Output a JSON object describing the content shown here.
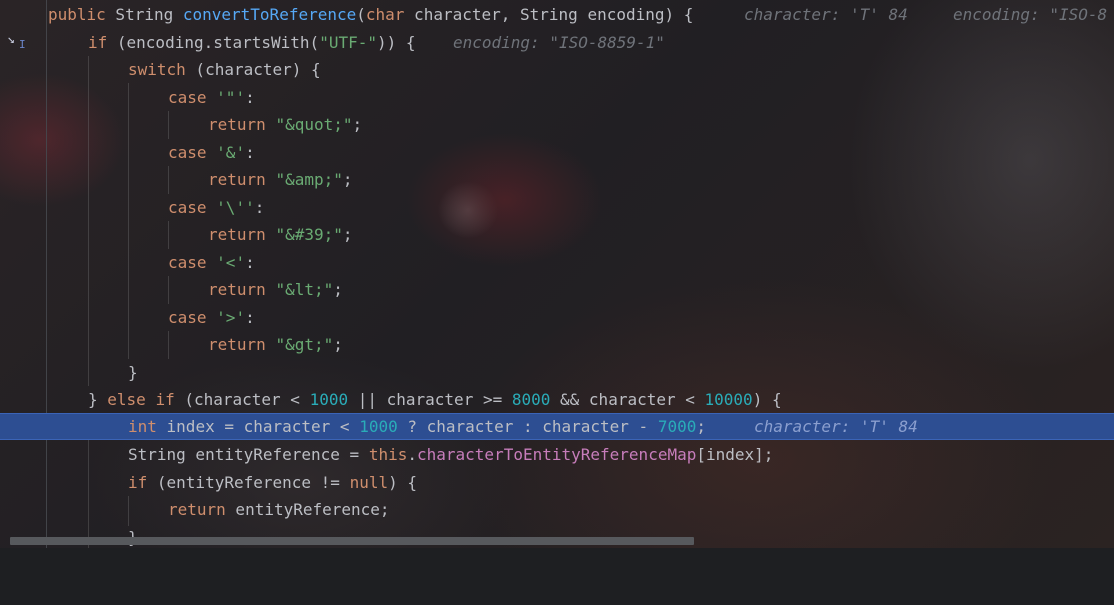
{
  "colors": {
    "keyword": "#cf8e6d",
    "method": "#56a8f5",
    "string": "#6aab73",
    "number": "#2aacb8",
    "field": "#c77dbb",
    "text": "#bcbec4",
    "inline_hint": "#6f737a",
    "execution_line": "#2d4e92"
  },
  "gutter": {
    "execution_marker_icon": "step-into-arrow-icon"
  },
  "code": {
    "l1": {
      "kw1": "public",
      "t1": " String ",
      "fn": "convertToReference",
      "t2": "(",
      "kw2": "char",
      "t3": " character, String encoding) {",
      "hint1": "character: 'T' 84",
      "hint2": "encoding: \"ISO-8"
    },
    "l2": {
      "kw": "if",
      "t1": " (encoding.startsWith(",
      "s": "\"UTF-\"",
      "t2": ")) {",
      "hint": "encoding: \"ISO-8859-1\""
    },
    "l3": {
      "kw": "switch",
      "t": " (character) {"
    },
    "l4": {
      "kw": "case",
      "s": "'\"'",
      "t": ":"
    },
    "l5": {
      "kw": "return",
      "s": "\"&quot;\"",
      "t": ";"
    },
    "l6": {
      "kw": "case",
      "s": "'&'",
      "t": ":"
    },
    "l7": {
      "kw": "return",
      "s": "\"&amp;\"",
      "t": ";"
    },
    "l8": {
      "kw": "case",
      "s": "'\\''",
      "t": ":"
    },
    "l9": {
      "kw": "return",
      "s": "\"&#39;\"",
      "t": ";"
    },
    "l10": {
      "kw": "case",
      "s": "'<'",
      "t": ":"
    },
    "l11": {
      "kw": "return",
      "s": "\"&lt;\"",
      "t": ";"
    },
    "l12": {
      "kw": "case",
      "s": "'>'",
      "t": ":"
    },
    "l13": {
      "kw": "return",
      "s": "\"&gt;\"",
      "t": ";"
    },
    "l14": {
      "t": "}"
    },
    "l15": {
      "t1": "} ",
      "kw1": "else",
      "t2": " ",
      "kw2": "if",
      "t3": " (character < ",
      "n1": "1000",
      "t4": " || character >= ",
      "n2": "8000",
      "t5": " && character < ",
      "n3": "10000",
      "t6": ") {"
    },
    "l16": {
      "kw": "int",
      "t1": " index = character < ",
      "n1": "1000",
      "t2": " ? character : character - ",
      "n2": "7000",
      "t3": ";",
      "hint": "character: 'T' 84"
    },
    "l17": {
      "t1": "String entityReference = ",
      "kw": "this",
      "t2": ".",
      "field": "characterToEntityReferenceMap",
      "t3": "[index];"
    },
    "l18": {
      "kw1": "if",
      "t1": " (entityReference != ",
      "kw2": "null",
      "t2": ") {"
    },
    "l19": {
      "kw": "return",
      "t": " entityReference;"
    },
    "l20": {
      "t": "}"
    }
  }
}
